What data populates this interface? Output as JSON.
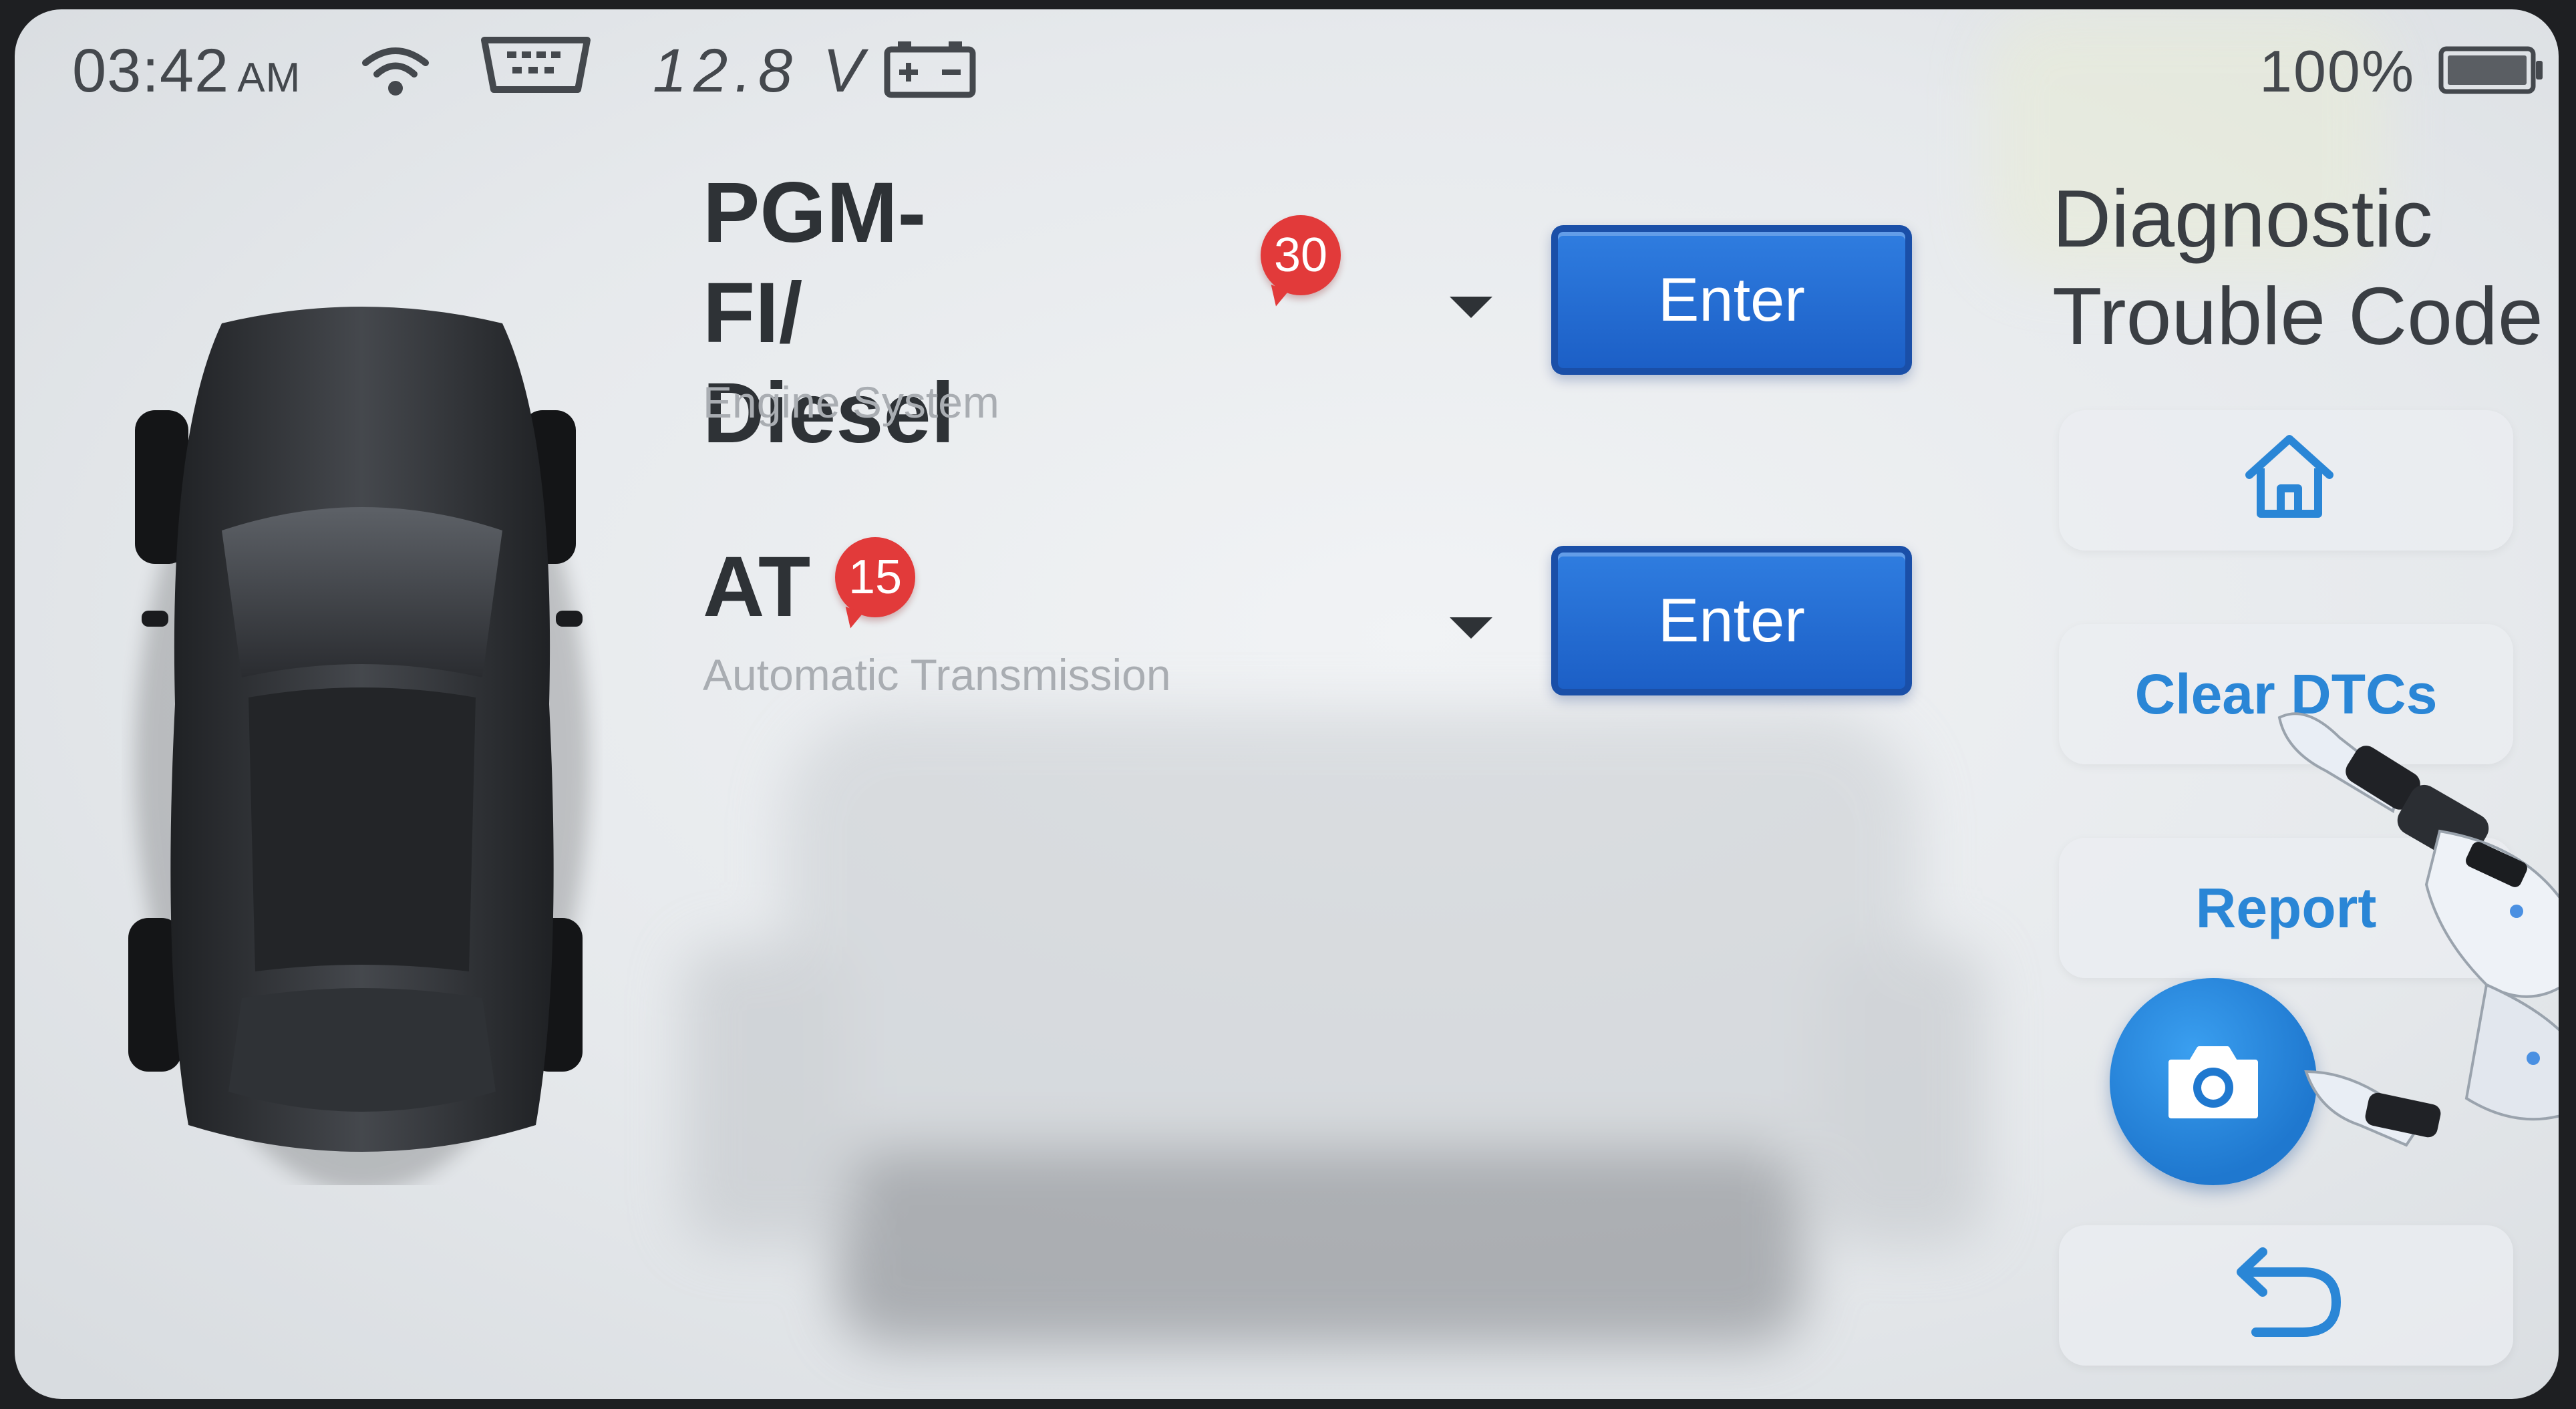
{
  "status_bar": {
    "time": "03:42",
    "ampm": "AM",
    "voltage": "12.8 V",
    "battery_percent": "100%",
    "icons": [
      "wifi-icon",
      "obd-connector-icon",
      "car-battery-icon",
      "device-battery-icon"
    ]
  },
  "systems": [
    {
      "title_line1": "PGM-FI/",
      "title_line2": "Diesel",
      "subtitle": "Engine System",
      "dtc_count": "30",
      "button_label": "Enter"
    },
    {
      "title_line1": "AT",
      "subtitle": "Automatic Transmission",
      "dtc_count": "15",
      "button_label": "Enter"
    }
  ],
  "panel": {
    "title_line1": "Diagnostic",
    "title_line2": "Trouble Code",
    "home_icon": "home-icon",
    "clear_label": "Clear DTCs",
    "report_label": "Report",
    "camera_icon": "camera-icon",
    "back_icon": "back-arrow-icon"
  },
  "colors": {
    "accent_blue": "#2a86d6",
    "button_blue": "#1c5fc6",
    "badge_red": "#e23a3a",
    "title_dark": "#2e3236",
    "subtitle_gray": "#a9adb2"
  }
}
